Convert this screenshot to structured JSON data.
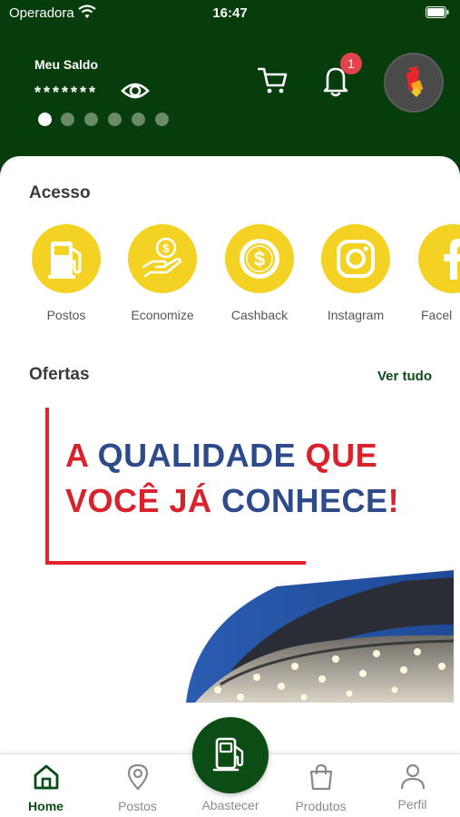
{
  "status_bar": {
    "carrier": "Operadora",
    "time": "16:47"
  },
  "balance": {
    "label": "Meu Saldo",
    "value": "*******",
    "dots_total": 6,
    "dots_active_index": 0
  },
  "notifications": {
    "count": "1"
  },
  "access": {
    "title": "Acesso",
    "items": [
      {
        "label": "Postos",
        "icon": "fuel-pump-icon"
      },
      {
        "label": "Economize",
        "icon": "hand-coin-icon"
      },
      {
        "label": "Cashback",
        "icon": "dollar-coin-icon"
      },
      {
        "label": "Instagram",
        "icon": "instagram-icon"
      },
      {
        "label": "Facel",
        "icon": "facebook-icon"
      }
    ]
  },
  "offers": {
    "title": "Ofertas",
    "see_all": "Ver tudo",
    "banner": {
      "line1": {
        "part1": "A ",
        "part2": "QUALIDADE ",
        "part3": "QUE"
      },
      "line2": {
        "part1": "VOCÊ JÁ ",
        "part2": "CONHECE",
        "part3": "!"
      }
    }
  },
  "bottom_nav": {
    "items": [
      {
        "label": "Home",
        "icon": "home-icon",
        "active": true
      },
      {
        "label": "Postos",
        "icon": "location-pin-icon",
        "active": false
      },
      {
        "label": "Abastecer",
        "icon": "fuel-pump-icon",
        "active": false
      },
      {
        "label": "Produtos",
        "icon": "shopping-bag-icon",
        "active": false
      },
      {
        "label": "Perfil",
        "icon": "person-icon",
        "active": false
      }
    ]
  },
  "colors": {
    "header_green": "#073d0c",
    "accent_yellow": "#f4d223",
    "brand_green": "#0b4d14",
    "badge_red": "#e3434b"
  }
}
